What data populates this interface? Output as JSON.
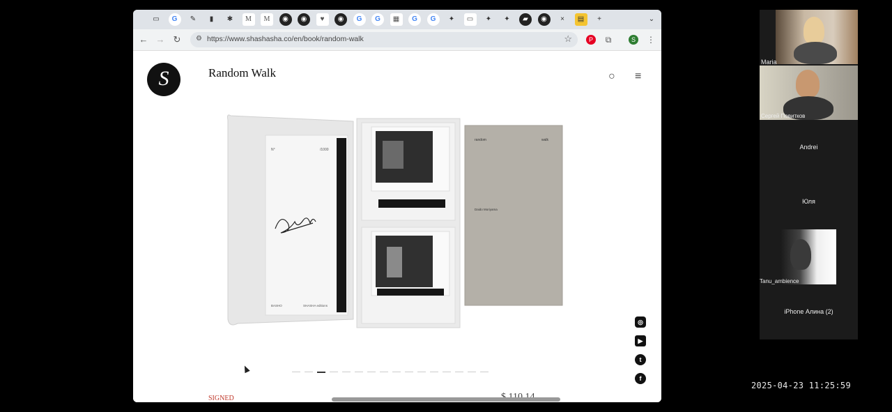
{
  "browser": {
    "url": "https://www.shashasha.co/en/book/random-walk",
    "tabs": [
      {
        "icon": "window-icon",
        "glyph": "▭"
      },
      {
        "icon": "google-icon",
        "glyph": "G"
      },
      {
        "icon": "pen-icon",
        "glyph": "✎"
      },
      {
        "icon": "bookmark-icon",
        "glyph": "▮"
      },
      {
        "icon": "asterisk-icon",
        "glyph": "✱"
      },
      {
        "icon": "gmail-icon",
        "glyph": "M"
      },
      {
        "icon": "gmail-icon",
        "glyph": "M"
      },
      {
        "icon": "openai-icon",
        "glyph": "◉"
      },
      {
        "icon": "openai-icon",
        "glyph": "◉"
      },
      {
        "icon": "heart-icon",
        "glyph": "♥"
      },
      {
        "icon": "openai-icon",
        "glyph": "◉"
      },
      {
        "icon": "google-icon",
        "glyph": "G"
      },
      {
        "icon": "google-icon",
        "glyph": "G"
      },
      {
        "icon": "image-icon",
        "glyph": "▦"
      },
      {
        "icon": "google-icon",
        "glyph": "G"
      },
      {
        "icon": "google-icon",
        "glyph": "G"
      },
      {
        "icon": "sparkle-icon",
        "glyph": "✦"
      },
      {
        "icon": "card-icon",
        "glyph": "▭"
      },
      {
        "icon": "sparkle-icon",
        "glyph": "✦"
      },
      {
        "icon": "sparkle-icon",
        "glyph": "✦"
      },
      {
        "icon": "terminal-icon",
        "glyph": "▰"
      },
      {
        "icon": "openai-icon",
        "glyph": "◉"
      }
    ],
    "close_tab": "×",
    "new_tab": "+",
    "more_tabs": "⌄"
  },
  "page": {
    "title": "Random Walk",
    "product_labels": {
      "box_number": "/1000",
      "box_left_footer": "BASHO",
      "box_right_footer": "SHASHA editions",
      "book_title_left": "random",
      "book_title_right": "walk",
      "book_author": "Daido Moriyama"
    },
    "signed_label": "SIGNED",
    "price_partial": "$ 110.14",
    "carousel": {
      "count": 16,
      "active_index": 2
    },
    "social": [
      "instagram-icon",
      "youtube-icon",
      "twitter-icon",
      "facebook-icon"
    ]
  },
  "meeting": {
    "participants": [
      {
        "name": "Maria",
        "video": true
      },
      {
        "name": "Сергей Повитков",
        "video": true
      },
      {
        "name": "Andrei",
        "video": false
      },
      {
        "name": "Юля",
        "video": false
      },
      {
        "name": "Tanu_ambience",
        "video": true
      },
      {
        "name": "iPhone Алина (2)",
        "video": false
      }
    ]
  },
  "timestamp": "2025-04-23  11:25:59"
}
